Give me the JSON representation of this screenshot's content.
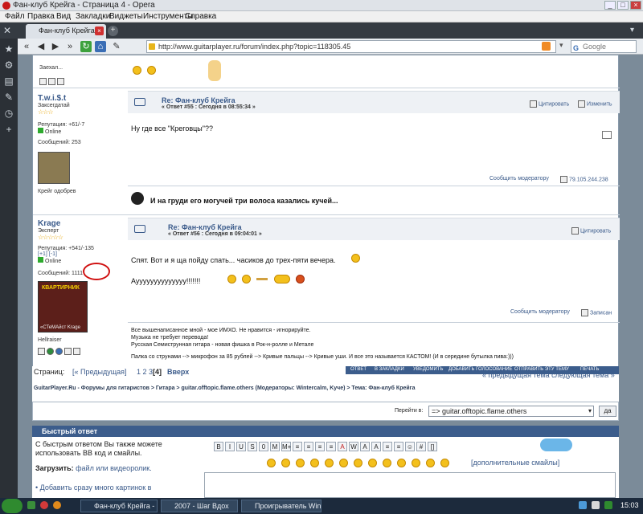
{
  "window": {
    "title": "Фан-клуб Крейга - Страница 4 - Opera"
  },
  "menu": [
    "Файл",
    "Правка",
    "Вид",
    "Закладки",
    "Виджеты",
    "Инструменты",
    "Справка"
  ],
  "tab": {
    "label": "Фан-клуб Крейга - Стр..."
  },
  "address": {
    "url": "http://www.guitarplayer.ru/forum/index.php?topic=118305.45",
    "search_placeholder": "Google"
  },
  "top_fragment": {
    "text": "Заехал..."
  },
  "post55": {
    "author": "T.w.i.$.t",
    "rank": "Заксегдатай",
    "stars": "☆☆☆",
    "reputation": "Репутация: +61/-7",
    "status": "Online",
    "messages": "Сообщений: 253",
    "avatar_caption": "Крейг одобрев",
    "subject": "Re: Фан-клуб Крейга",
    "meta": "« Ответ #55 : Сегодня в 08:55:34 »",
    "quote": "Цитировать",
    "edit": "Изменить",
    "body": "Ну где все \"Креговцы\"??",
    "report": "Сообщить модератору",
    "ip": "79.105.244.238"
  },
  "signature_line": "И на груди его могучей три волоса казались кучей...",
  "post56": {
    "author": "Krage",
    "rank": "Эксперт",
    "stars": "☆☆☆☆☆",
    "reputation": "Репутация: +541/-135",
    "rep_links": "[+1] [-1]",
    "status": "Online",
    "messages": "Сообщений: 1111",
    "avatar_text": "КВАРТИРНИК",
    "avatar_caption2": "«СТеМАйст Krage",
    "user_title": "Hellraiser",
    "subject": "Re: Фан-клуб Крейга",
    "meta": "« Ответ #56 : Сегодня в 09:04:01 »",
    "quote": "Цитировать",
    "body1": "Спят. Вот и я ща пойду спать... часиков до трех-пяти вечера.",
    "body2": "Ауууууууууууууу!!!!!!!",
    "report": "Сообщить модератору",
    "logged": "Записан",
    "sig": [
      "Все вышенаписанное мной - мое ИМХО. Не нравится - игнорируйте.",
      "Музыка не требует перевода!",
      "Русская Семиструнная гитара - новая фишка в Рок-н-ролле и Метале",
      "Палка со струнами --> микрофон за 85 рублей --> Кривые пальцы --> Кривые уши. И все это называется КАСТОМ! (И в середине бутылка пива:)))"
    ]
  },
  "pagination": {
    "label": "Страниц:",
    "prev": "[« Предыдущая]",
    "pages": "1 2 3",
    "current": "[4]",
    "up": "Вверх",
    "actions": [
      "ОТВЕТ",
      "В ЗАКЛАДКИ",
      "УВЕДОМИТЬ",
      "ДОБАВИТЬ ГОЛОСОВАНИЕ",
      "ОТПРАВИТЬ ЭТУ ТЕМУ",
      "ПЕЧАТЬ"
    ],
    "topic_nav": "« предыдущая тема следующая тема »"
  },
  "breadcrumb": "GuitarPlayer.Ru - Форумы для гитаристов > Гитара > guitar.offtopic.flame.others (Модераторы: Wintercalm, Kyче) > Тема: Фан-клуб Крейга",
  "jump": {
    "label": "Перейти в:",
    "value": "=> guitar.offtopic.flame.others",
    "go": "да"
  },
  "quick_reply": {
    "header": "Быстрый ответ",
    "text1": "С быстрым ответом Вы также можете использовать BB код и смайлы.",
    "upload_label": "Загрузить:",
    "upload_links": "файл или видеоролик.",
    "add_link": "• Добавить сразу много картинок в",
    "more_smileys": "[дополнительные смайлы]",
    "format_buttons": [
      "B",
      "I",
      "U",
      "S",
      "0",
      "M",
      "M+",
      "≡",
      "≡",
      "≡",
      "≡",
      "A",
      "W",
      "A",
      "A",
      "≡",
      "≡",
      "☺",
      "#",
      "[]"
    ]
  },
  "taskbar": {
    "items": [
      "Фан-клуб Крейга - С...",
      "2007 - Шаг Вдох",
      "Проигрыватель Wind..."
    ],
    "clock": "15:03"
  }
}
